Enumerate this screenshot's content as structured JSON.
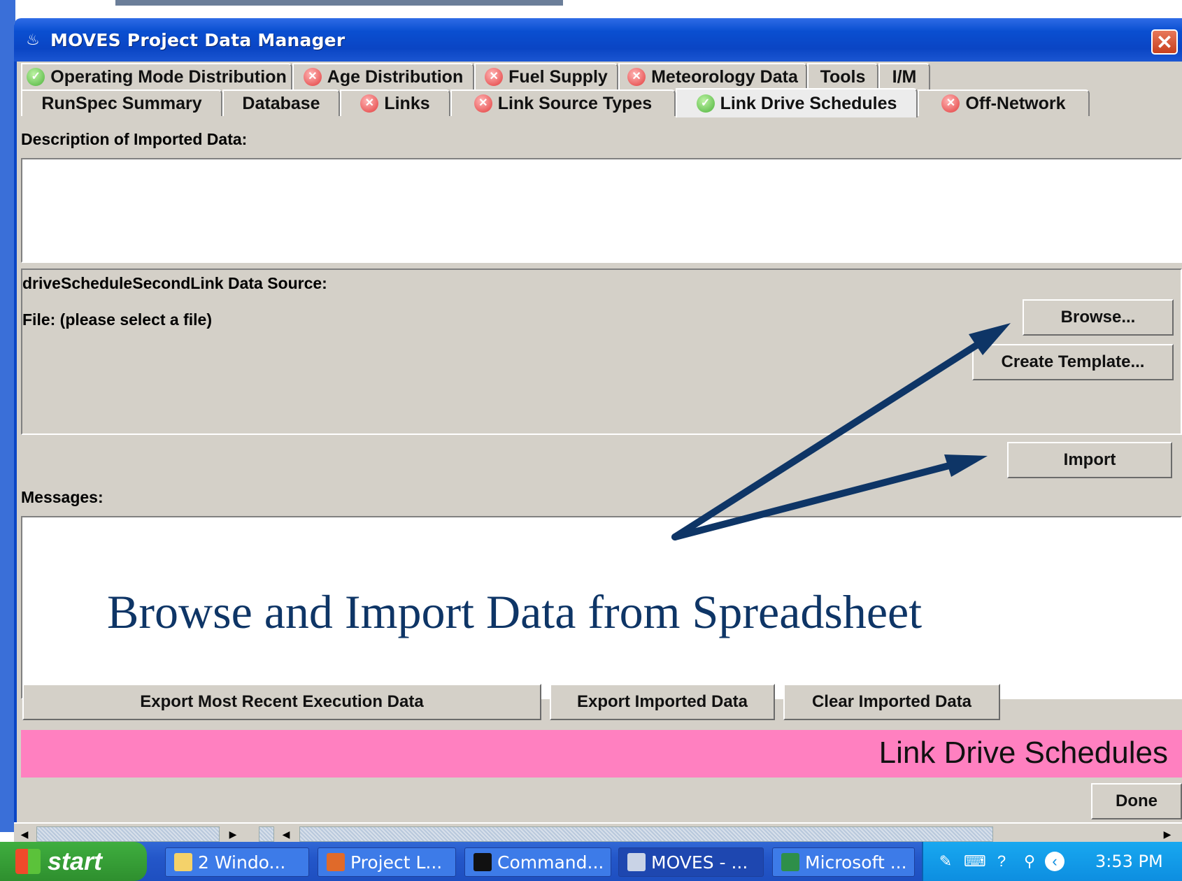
{
  "window": {
    "title": "MOVES Project Data Manager",
    "close_label": "✕"
  },
  "tabs_top": [
    {
      "label": "Operating Mode Distribution",
      "status": "ok"
    },
    {
      "label": "Age Distribution",
      "status": "error"
    },
    {
      "label": "Fuel Supply",
      "status": "error"
    },
    {
      "label": "Meteorology Data",
      "status": "error"
    },
    {
      "label": "Tools",
      "status": "none"
    },
    {
      "label": "I/M",
      "status": "none"
    }
  ],
  "tabs_bottom": [
    {
      "label": "RunSpec Summary",
      "status": "none"
    },
    {
      "label": "Database",
      "status": "none"
    },
    {
      "label": "Links",
      "status": "error"
    },
    {
      "label": "Link Source Types",
      "status": "error"
    },
    {
      "label": "Link Drive Schedules",
      "status": "ok",
      "active": true
    },
    {
      "label": "Off-Network",
      "status": "error"
    }
  ],
  "content": {
    "description_label": "Description of Imported Data:",
    "description_value": "",
    "data_source_label": "driveScheduleSecondLink Data Source:",
    "file_label": "File: (please select a file)",
    "browse_label": "Browse...",
    "create_template_label": "Create Template...",
    "import_label": "Import",
    "messages_label": "Messages:",
    "messages_value": "",
    "export_recent_label": "Export Most Recent Execution Data",
    "export_imported_label": "Export Imported Data",
    "clear_imported_label": "Clear Imported Data",
    "banner_text": "Link Drive Schedules",
    "done_label": "Done"
  },
  "annotation": {
    "text": "Browse and Import Data from Spreadsheet",
    "color": "#0e3566"
  },
  "taskbar": {
    "start_label": "start",
    "items": [
      {
        "label": "2 Windo...",
        "icon": "folder-icon"
      },
      {
        "label": "Project L...",
        "icon": "powerpoint-icon"
      },
      {
        "label": "Command...",
        "icon": "console-icon"
      },
      {
        "label": "MOVES - ...",
        "icon": "java-icon",
        "active": true
      },
      {
        "label": "Microsoft ...",
        "icon": "excel-icon"
      }
    ],
    "clock": "3:53 PM"
  },
  "colors": {
    "banner": "#ff80c0",
    "titlebar": "#0a4fd1",
    "ok_status": "#4cb23a",
    "error_status": "#e23b3b"
  }
}
